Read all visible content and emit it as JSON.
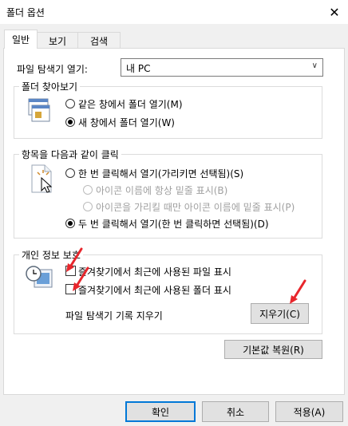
{
  "window": {
    "title": "폴더 옵션",
    "close_glyph": "✕"
  },
  "tabs": [
    {
      "label": "일반"
    },
    {
      "label": "보기"
    },
    {
      "label": "검색"
    }
  ],
  "open_explorer": {
    "label": "파일 탐색기 열기:",
    "selected": "내 PC"
  },
  "browse_folders": {
    "title": "폴더 찾아보기",
    "options": [
      {
        "label": "같은 창에서 폴더 열기(M)",
        "checked": false
      },
      {
        "label": "새 창에서 폴더 열기(W)",
        "checked": true
      }
    ]
  },
  "click_items": {
    "title": "항목을 다음과 같이 클릭",
    "options": [
      {
        "label": "한 번 클릭해서 열기(가리키면 선택됨)(S)",
        "checked": false
      },
      {
        "label": "아이콘 이름에 항상 밑줄 표시(B)",
        "disabled": true
      },
      {
        "label": "아이콘을 가리킬 때만 아이콘 이름에 밑줄 표시(P)",
        "disabled": true
      },
      {
        "label": "두 번 클릭해서 열기(한 번 클릭하면 선택됨)(D)",
        "checked": true
      }
    ]
  },
  "privacy": {
    "title": "개인 정보 보호",
    "options": [
      {
        "label": "즐겨찾기에서 최근에 사용된 파일 표시",
        "checked": false
      },
      {
        "label": "즐겨찾기에서 최근에 사용된 폴더 표시",
        "checked": false
      }
    ],
    "clear_history_label": "파일 탐색기 기록 지우기",
    "clear_button": "지우기(C)"
  },
  "restore_defaults_button": "기본값 복원(R)",
  "footer": {
    "ok": "확인",
    "cancel": "취소",
    "apply": "적용(A)"
  },
  "colors": {
    "annotation_arrow": "#e8262c",
    "accent_border": "#0078d7"
  }
}
